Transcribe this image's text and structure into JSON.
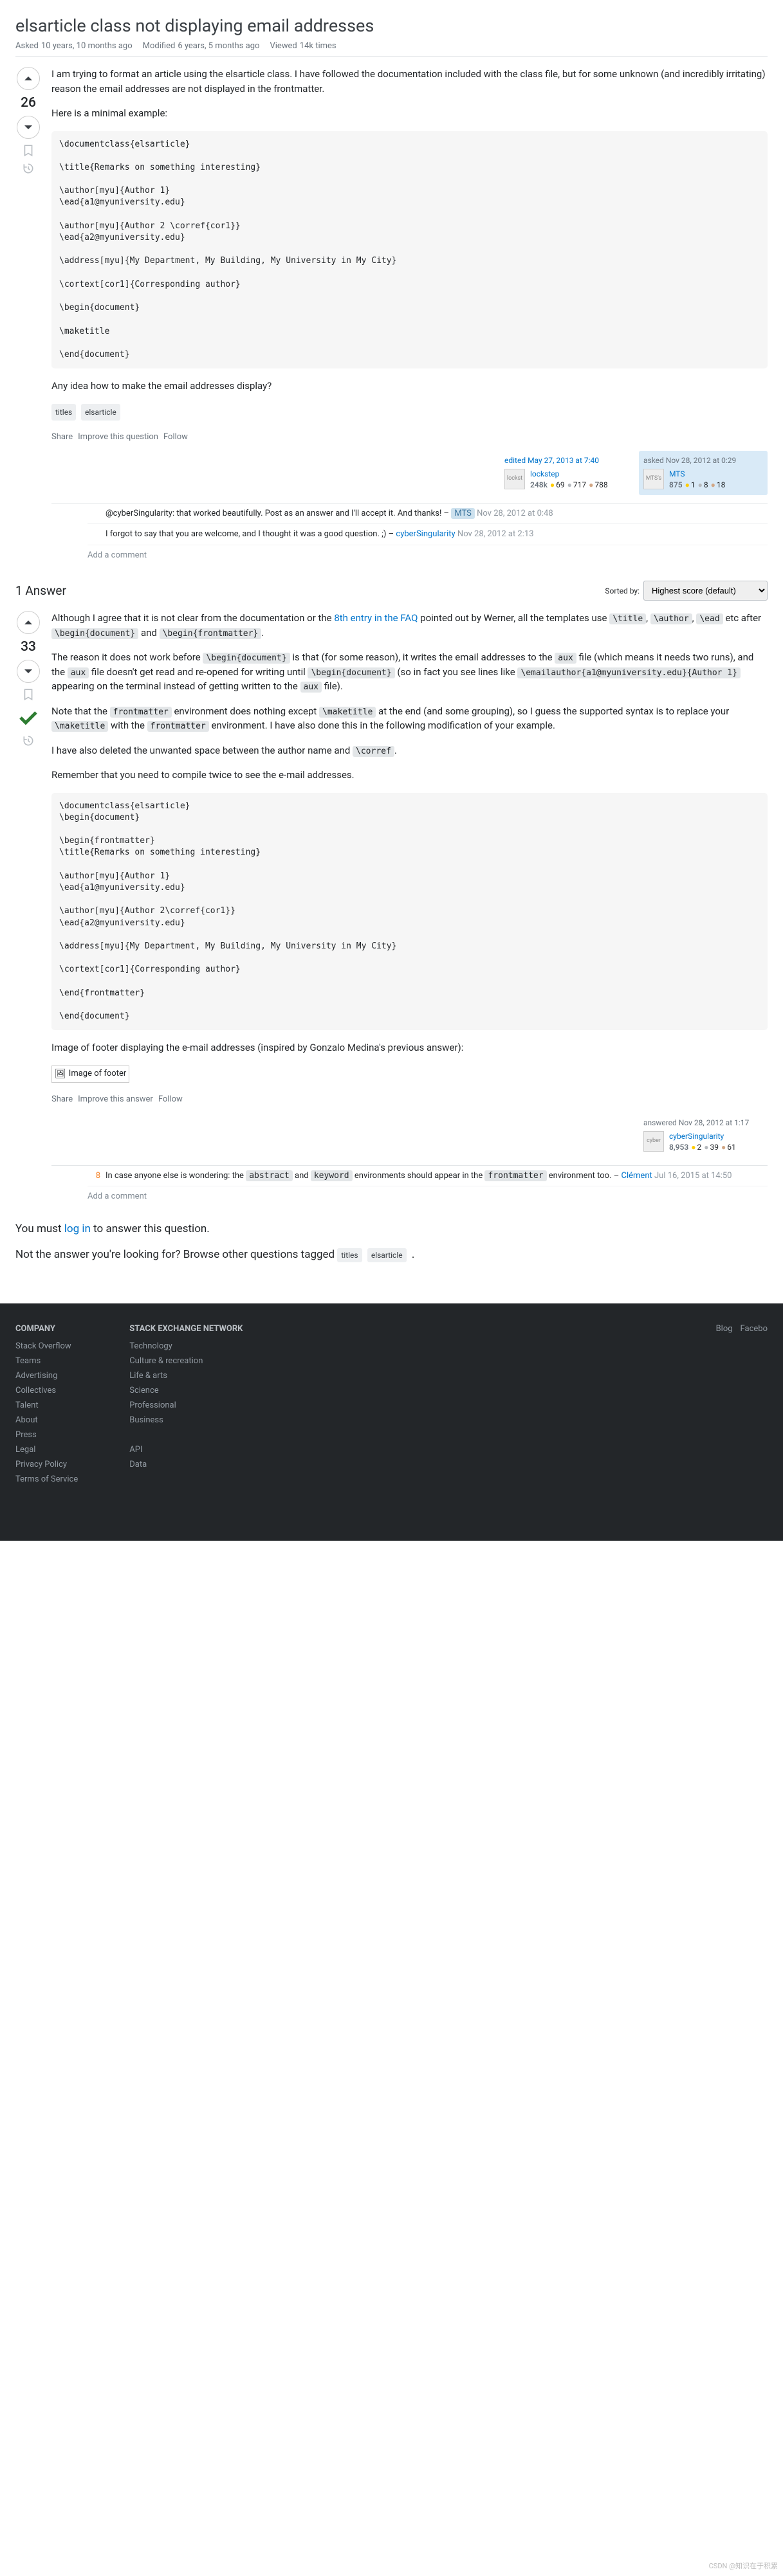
{
  "question": {
    "title": "elsarticle class not displaying email addresses",
    "asked_label": "Asked",
    "asked_value": "10 years, 10 months ago",
    "modified_label": "Modified",
    "modified_value": "6 years, 5 months ago",
    "viewed_label": "Viewed",
    "viewed_value": "14k times",
    "score": "26",
    "body_p1": "I am trying to format an article using the elsarticle class. I have followed the documentation included with the class file, but for some unknown (and incredibly irritating) reason the email addresses are not displayed in the frontmatter.",
    "body_p2": "Here is a minimal example:",
    "code1": "\\documentclass{elsarticle}\n\n\\title{Remarks on something interesting}\n\n\\author[myu]{Author 1}\n\\ead{a1@myuniversity.edu}\n\n\\author[myu]{Author 2 \\corref{cor1}}\n\\ead{a2@myuniversity.edu}\n\n\\address[myu]{My Department, My Building, My University in My City}\n\n\\cortext[cor1]{Corresponding author}\n\n\\begin{document}\n\n\\maketitle\n\n\\end{document}",
    "body_p3": "Any idea how to make the email addresses display?",
    "tags": [
      "titles",
      "elsarticle"
    ],
    "actions": {
      "share": "Share",
      "improve": "Improve this question",
      "follow": "Follow"
    },
    "editor": {
      "action": "edited May 27, 2013 at 7:40",
      "name": "lockstep",
      "avatar_alt": "lockst",
      "rep": "248k",
      "gold": "69",
      "silver": "717",
      "bronze": "788"
    },
    "owner": {
      "action": "asked Nov 28, 2012 at 0:29",
      "name": "MTS",
      "avatar_alt": "MTS's",
      "rep": "875",
      "gold": "1",
      "silver": "8",
      "bronze": "18"
    },
    "comments": [
      {
        "text": "@cyberSingularity: that worked beautifully. Post as an answer and I'll accept it. And thanks! – ",
        "user": "MTS",
        "user_is_owner": true,
        "date": "Nov 28, 2012 at 0:48"
      },
      {
        "text": "I forgot to say that you are welcome, and I thought it was a good question. ;) – ",
        "user": "cyberSingularity",
        "user_is_owner": false,
        "date": "Nov 28, 2012 at 2:13"
      }
    ],
    "add_comment": "Add a comment"
  },
  "answers_header": {
    "count_text": "1 Answer",
    "sorted_by_label": "Sorted by:",
    "sort_selected": "Highest score (default)"
  },
  "answer": {
    "score": "33",
    "accepted": true,
    "p1_a": "Although I agree that it is not clear from the documentation or the ",
    "p1_link": "8th entry in the FAQ",
    "p1_b": " pointed out by Werner, all the templates use ",
    "p1_code": [
      "\\title",
      "\\author",
      "\\ead"
    ],
    "p1_c": " etc after ",
    "p1_code2": "\\begin{document}",
    "p1_d": " and ",
    "p1_code3": "\\begin{frontmatter}",
    "p1_e": ".",
    "p2_a": "The reason it does not work before ",
    "p2_code1": "\\begin{document}",
    "p2_b": " is that (for some reason), it writes the email addresses to the ",
    "p2_code2": "aux",
    "p2_c": " file (which means it needs two runs), and the ",
    "p2_code3": "aux",
    "p2_d": " file doesn't get read and re-opened for writing until ",
    "p2_code4": "\\begin{document}",
    "p2_e": " (so in fact you see lines like ",
    "p2_code5": "\\emailauthor{a1@myuniversity.edu}{Author 1}",
    "p2_f": " appearing on the terminal instead of getting written to the ",
    "p2_code6": "aux",
    "p2_g": " file).",
    "p3_a": "Note that the ",
    "p3_code1": "frontmatter",
    "p3_b": " environment does nothing except ",
    "p3_code2": "\\maketitle",
    "p3_c": " at the end (and some grouping), so I guess the supported syntax is to replace your ",
    "p3_code3": "\\maketitle",
    "p3_d": " with the ",
    "p3_code4": "frontmatter",
    "p3_e": " environment. I have also done this in the following modification of your example.",
    "p4_a": "I have also deleted the unwanted space between the author name and ",
    "p4_code1": "\\corref",
    "p4_b": ".",
    "p5": "Remember that you need to compile twice to see the e-mail addresses.",
    "code1": "\\documentclass{elsarticle}\n\\begin{document}\n\n\\begin{frontmatter}\n\\title{Remarks on something interesting}\n\n\\author[myu]{Author 1}\n\\ead{a1@myuniversity.edu}\n\n\\author[myu]{Author 2\\corref{cor1}}\n\\ead{a2@myuniversity.edu}\n\n\\address[myu]{My Department, My Building, My University in My City}\n\n\\cortext[cor1]{Corresponding author}\n\n\\end{frontmatter}\n\n\\end{document}",
    "p6": "Image of footer displaying the e-mail addresses (inspired by Gonzalo Medina's previous answer):",
    "img_alt": "Image of footer",
    "actions": {
      "share": "Share",
      "improve": "Improve this answer",
      "follow": "Follow"
    },
    "owner": {
      "action": "answered Nov 28, 2012 at 1:17",
      "name": "cyberSingularity",
      "avatar_alt": "cyber",
      "rep": "8,953",
      "gold": "2",
      "silver": "39",
      "bronze": "61"
    },
    "comments": [
      {
        "score": "8",
        "text_a": "In case anyone else is wondering: the ",
        "code1": "abstract",
        "text_b": " and ",
        "code2": "keyword",
        "text_c": " environments should appear in the ",
        "code3": "frontmatter",
        "text_d": " environment too. – ",
        "user": "Clément",
        "date": "Jul 16, 2015 at 14:50"
      }
    ],
    "add_comment": "Add a comment"
  },
  "login_prompt": {
    "prefix": "You must ",
    "link": "log in",
    "suffix": " to answer this question."
  },
  "related_prompt": {
    "prefix": "Not the answer you're looking for? Browse other questions tagged ",
    "tags": [
      "titles",
      "elsarticle"
    ],
    "suffix": " ."
  },
  "footer": {
    "company": {
      "title": "COMPANY",
      "links": [
        "Stack Overflow",
        "Teams",
        "Advertising",
        "Collectives",
        "Talent",
        "About",
        "Press",
        "Legal",
        "Privacy Policy",
        "Terms of Service"
      ]
    },
    "network": {
      "title": "STACK EXCHANGE NETWORK",
      "links": [
        "Technology",
        "Culture & recreation",
        "Life & arts",
        "Science",
        "Professional",
        "Business",
        "",
        "API",
        "Data"
      ]
    },
    "social": [
      "Blog",
      "Facebo"
    ]
  },
  "watermark": "CSDN @知识在于积累"
}
